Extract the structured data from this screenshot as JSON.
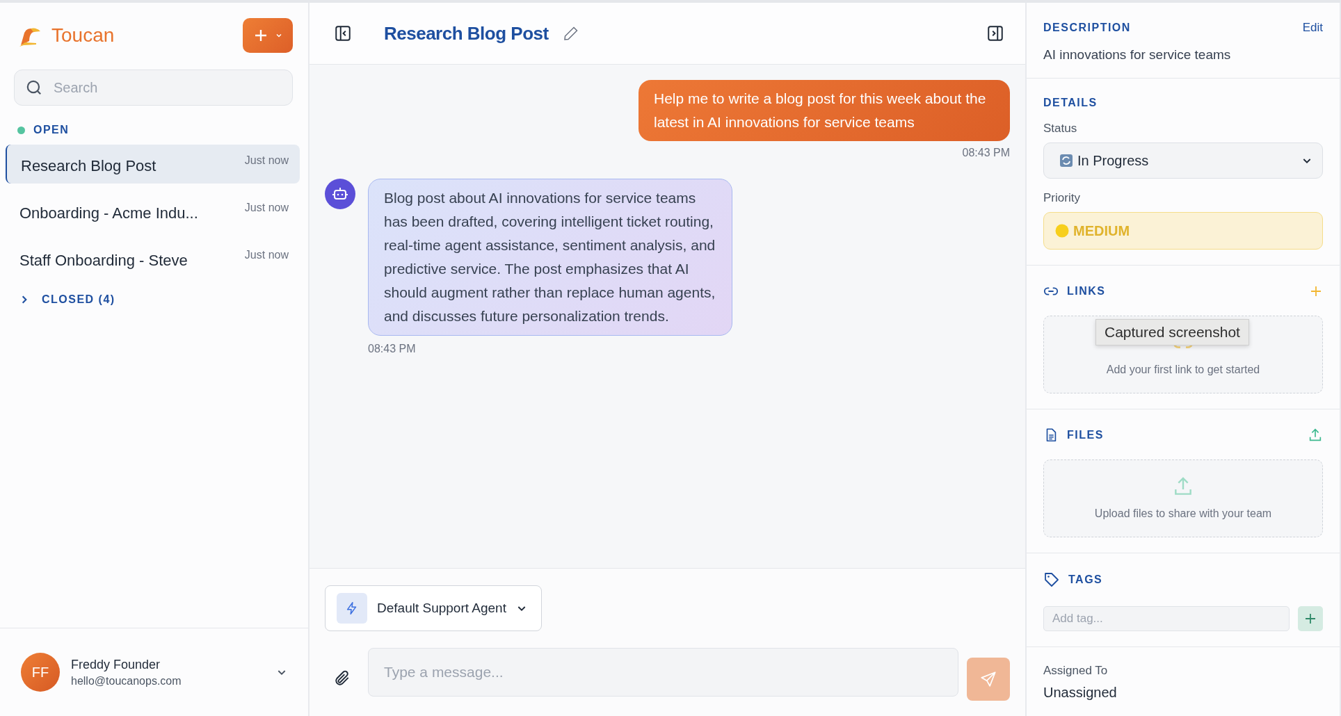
{
  "app": {
    "name": "Toucan"
  },
  "sidebar": {
    "search": {
      "placeholder": "Search"
    },
    "open_group": {
      "label": "OPEN",
      "items": [
        {
          "title": "Research Blog Post",
          "time": "Just now",
          "selected": true
        },
        {
          "title": "Onboarding - Acme Indu...",
          "time": "Just now",
          "selected": false
        },
        {
          "title": "Staff Onboarding - Steve",
          "time": "Just now",
          "selected": false
        }
      ]
    },
    "closed_group": {
      "label": "CLOSED (4)",
      "expanded": false
    },
    "user": {
      "initials": "FF",
      "name": "Freddy Founder",
      "email": "hello@toucanops.com"
    }
  },
  "chat": {
    "title": "Research Blog Post",
    "messages": [
      {
        "kind": "user",
        "text": "Help me to write a blog post for this week about the latest in AI innovations for service teams",
        "time": "08:43 PM"
      },
      {
        "kind": "assistant",
        "text": "Blog post about AI innovations for service teams has been drafted, covering intelligent ticket routing, real-time agent assistance, sentiment analysis, and predictive service. The post emphasizes that AI should augment rather than replace human agents, and discusses future personalization trends.",
        "time": "08:43 PM"
      }
    ],
    "agent": "Default Support Agent",
    "placeholder": "Type a message..."
  },
  "details": {
    "description": {
      "label": "DESCRIPTION",
      "edit": "Edit",
      "text": "AI innovations for service teams"
    },
    "details": {
      "label": "DETAILS",
      "status_label": "Status",
      "status": "In Progress",
      "priority_label": "Priority",
      "priority": "MEDIUM"
    },
    "links": {
      "label": "LINKS",
      "empty_text": "Add your first link to get started"
    },
    "tooltip": "Captured screenshot",
    "files": {
      "label": "FILES",
      "empty_text": "Upload files to share with your team"
    },
    "tags": {
      "label": "TAGS",
      "placeholder": "Add tag..."
    },
    "assigned": {
      "label": "Assigned To",
      "value": "Unassigned"
    }
  }
}
